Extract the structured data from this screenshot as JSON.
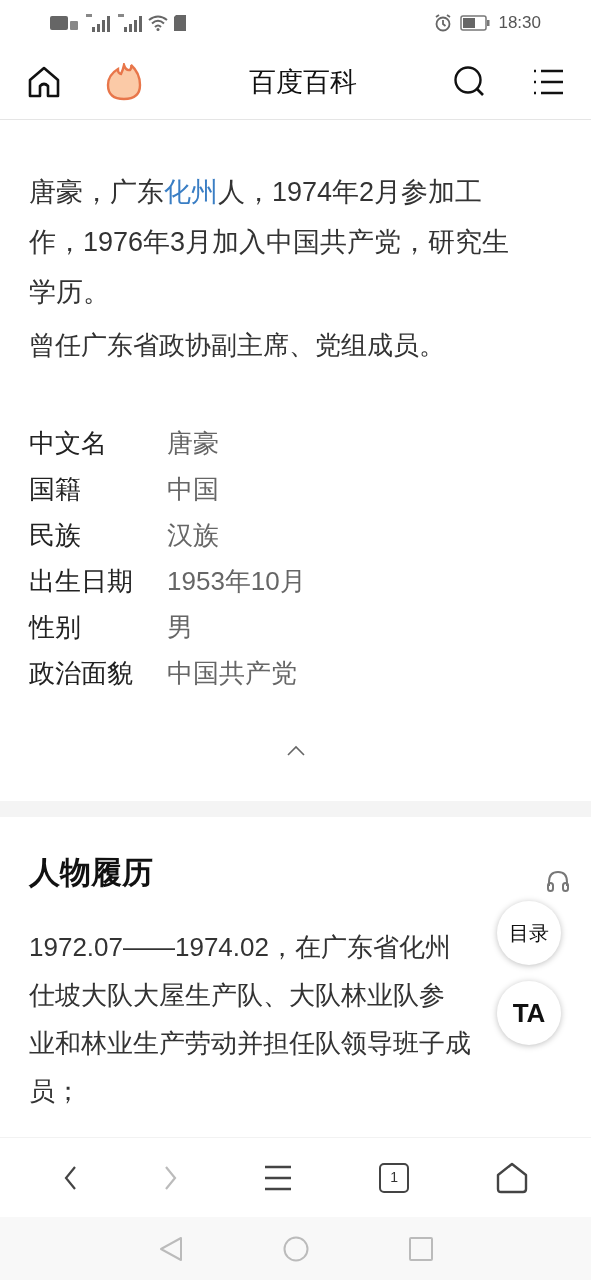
{
  "status_bar": {
    "time": "18:30"
  },
  "header": {
    "title": "百度百科"
  },
  "intro": [
    {
      "text": "唐豪，广东",
      "kind": "plain"
    },
    {
      "text": "化州",
      "kind": "link"
    },
    {
      "text": "人，1974年2月参加工作，1976年3月加入中国共产党，研究生学历。",
      "kind": "plain"
    }
  ],
  "summary": "曾任广东省政协副主席、党组成员。",
  "infobox": [
    {
      "label": "中文名",
      "value": "唐豪"
    },
    {
      "label": "国籍",
      "value": "中国"
    },
    {
      "label": "民族",
      "value": "汉族"
    },
    {
      "label": "出生日期",
      "value": "1953年10月"
    },
    {
      "label": "性别",
      "value": "男"
    },
    {
      "label": "政治面貌",
      "value": "中国共产党"
    }
  ],
  "section": {
    "title": "人物履历",
    "lines": [
      "1972.07——1974.02，在广东省化州",
      "仕坡大队大屋生产队、大队林业队参",
      "业和林业生产劳动并担任队领导班子成",
      "员；"
    ]
  },
  "floating": {
    "toc": "目录",
    "ta": "TA"
  },
  "bottom_nav": {
    "tab_count": "1"
  }
}
